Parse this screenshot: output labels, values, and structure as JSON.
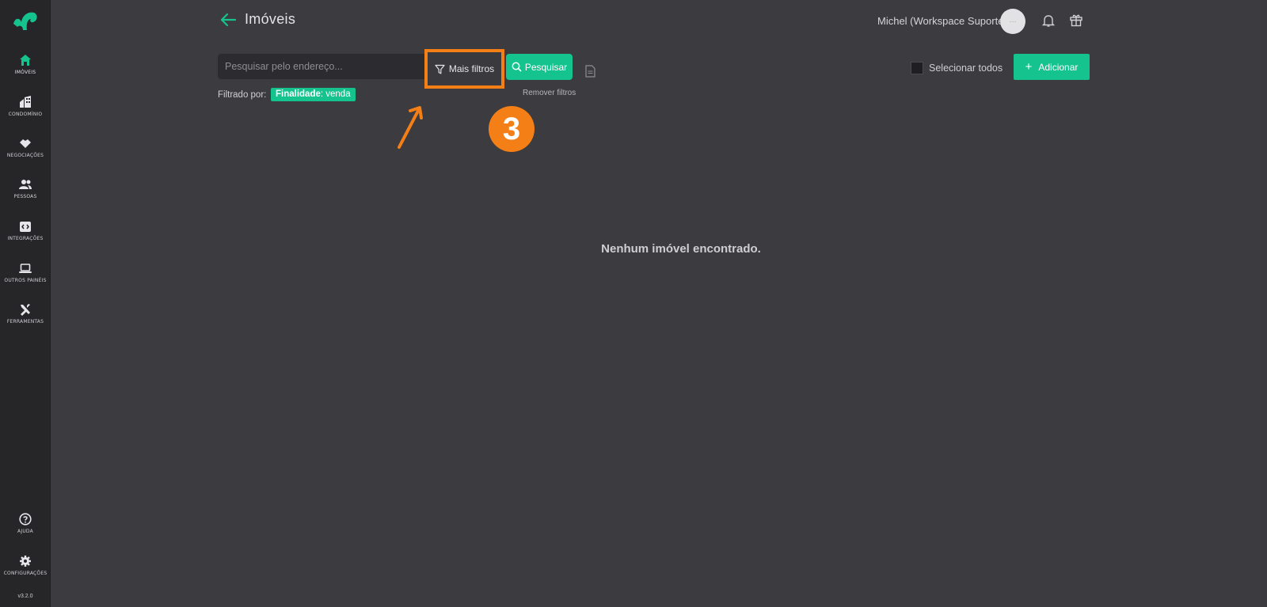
{
  "sidebar": {
    "items": [
      {
        "label": "IMÓVEIS",
        "icon": "home-icon"
      },
      {
        "label": "CONDOMÍNIO",
        "icon": "buildings-icon"
      },
      {
        "label": "NEGOCIAÇÕES",
        "icon": "handshake-icon"
      },
      {
        "label": "PESSOAS",
        "icon": "people-icon"
      },
      {
        "label": "INTEGRAÇÕES",
        "icon": "integrations-icon"
      },
      {
        "label": "OUTROS PAINÉIS",
        "icon": "laptop-icon"
      },
      {
        "label": "FERRAMENTAS",
        "icon": "tools-icon"
      }
    ],
    "bottom_items": [
      {
        "label": "AJUDA",
        "icon": "help-icon"
      },
      {
        "label": "CONFIGURAÇÕES",
        "icon": "gear-icon"
      }
    ],
    "version": "v3.2.0"
  },
  "header": {
    "title": "Imóveis",
    "user_name": "Michel (Workspace Suporte)"
  },
  "search": {
    "placeholder": "Pesquisar pelo endereço...",
    "more_filters_label": "Mais filtros",
    "search_button_label": "Pesquisar",
    "remove_filters_label": "Remover filtros",
    "filtered_by_label": "Filtrado por:",
    "active_filter": {
      "key": "Finalidade",
      "value": ": venda"
    }
  },
  "actions": {
    "select_all_label": "Selecionar todos",
    "add_label": "Adicionar"
  },
  "annotation": {
    "step_number": "3"
  },
  "empty_message": "Nenhum imóvel encontrado.",
  "colors": {
    "accent": "#14c38e",
    "annotation": "#f47f16",
    "background": "#3c3b40",
    "sidebar": "#262629"
  }
}
